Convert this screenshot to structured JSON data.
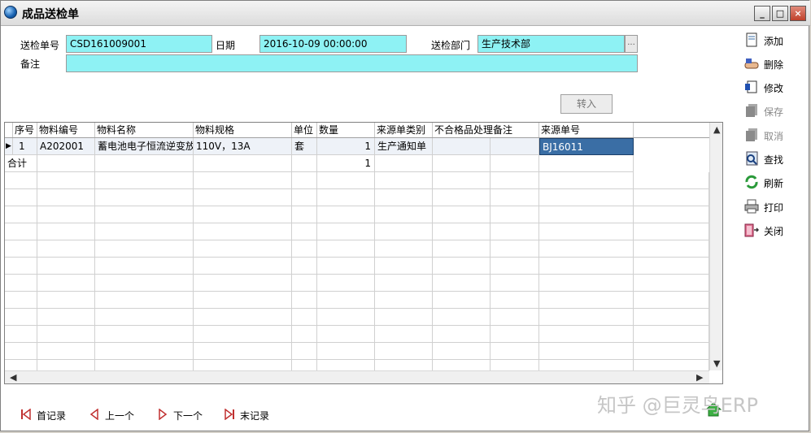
{
  "window": {
    "title": "成品送检单"
  },
  "form": {
    "doc_no_label": "送检单号",
    "doc_no_value": "CSD161009001",
    "date_label": "日期",
    "date_value": "2016-10-09 00:00:00",
    "dept_label": "送检部门",
    "dept_value": "生产技术部",
    "dept_button": "...",
    "note_label": "备注",
    "note_value": ""
  },
  "convert_button": "转入",
  "sidebar": [
    {
      "label": "添加",
      "icon": "add-doc-icon"
    },
    {
      "label": "删除",
      "icon": "delete-hand-icon"
    },
    {
      "label": "修改",
      "icon": "edit-icon"
    },
    {
      "label": "保存",
      "icon": "save-icon"
    },
    {
      "label": "取消",
      "icon": "cancel-icon"
    },
    {
      "label": "查找",
      "icon": "find-icon"
    },
    {
      "label": "刷新",
      "icon": "refresh-icon"
    },
    {
      "label": "打印",
      "icon": "printer-icon"
    },
    {
      "label": "关闭",
      "icon": "close-door-icon"
    }
  ],
  "table": {
    "columns": [
      "序号",
      "物料编号",
      "物料名称",
      "物料规格",
      "单位",
      "数量",
      "来源单类别",
      "不合格品处理备注",
      "来源单号"
    ],
    "rows": [
      [
        "1",
        "A202001",
        "蓄电池电子恒流逆变放",
        "110V，13A",
        "套",
        "1",
        "生产通知单",
        "",
        "",
        "BJ16011"
      ]
    ],
    "total_row": {
      "label": "合计",
      "qty": "1"
    }
  },
  "navigation": [
    {
      "label": "首记录",
      "icon": "first-record-icon"
    },
    {
      "label": "上一个",
      "icon": "prev-record-icon"
    },
    {
      "label": "下一个",
      "icon": "next-record-icon"
    },
    {
      "label": "末记录",
      "icon": "last-record-icon"
    }
  ],
  "watermark": "知乎 @巨灵鸟ERP"
}
